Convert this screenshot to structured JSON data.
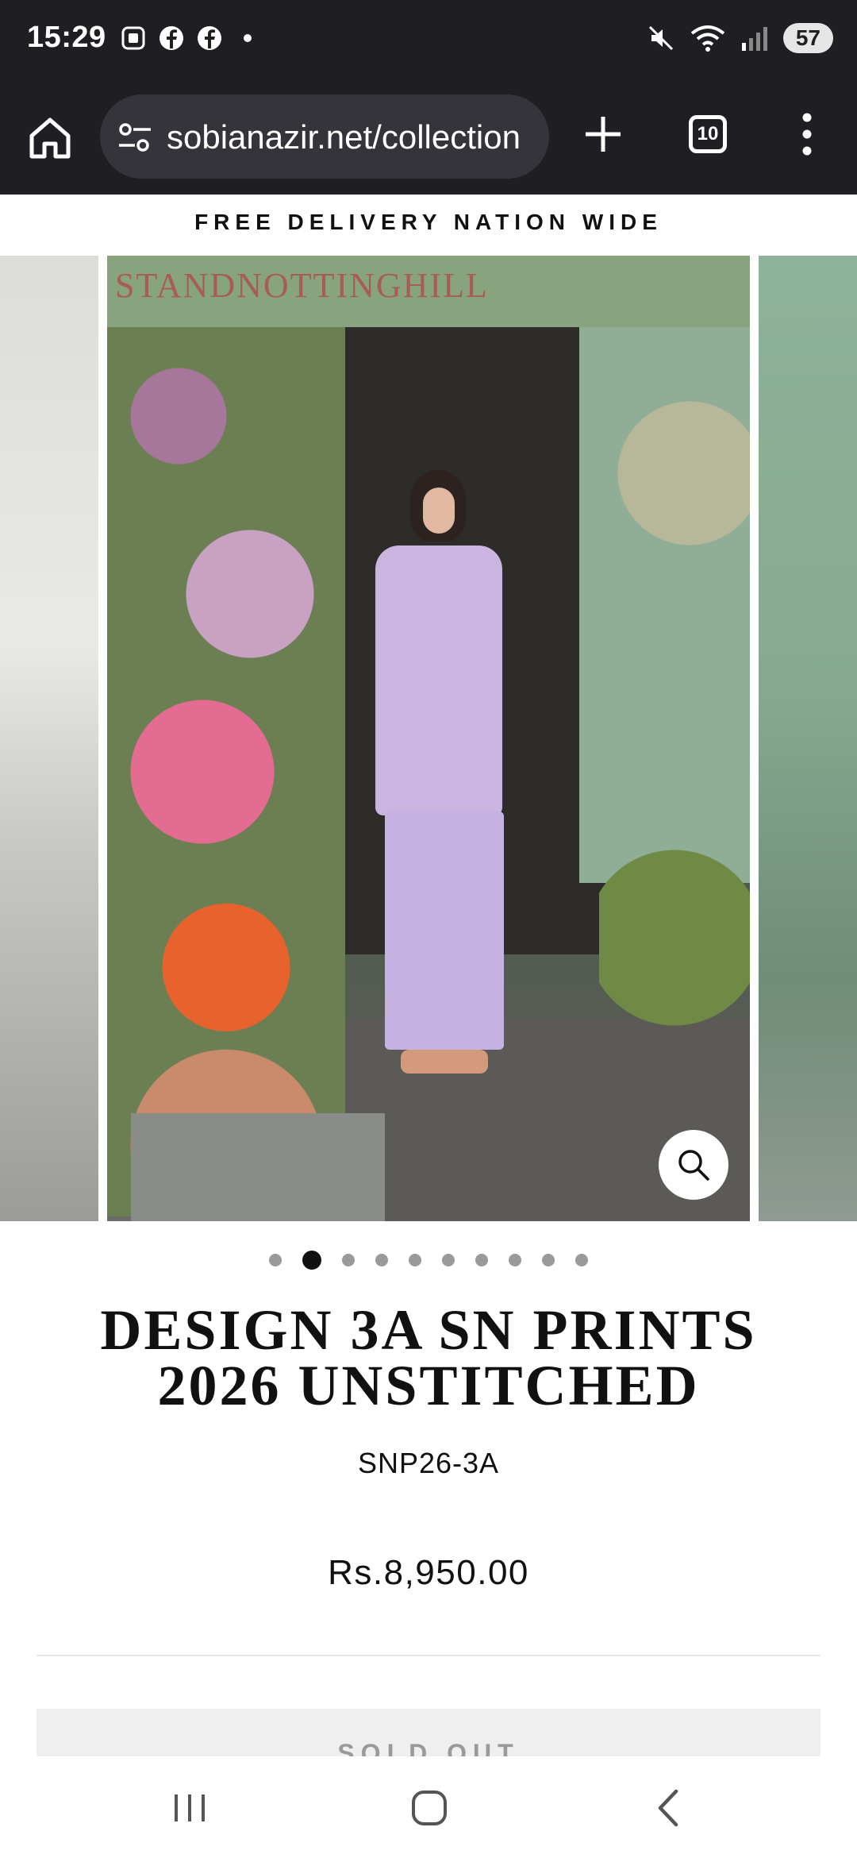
{
  "status_bar": {
    "time": "15:29",
    "battery": "57",
    "left_icons": [
      "screenshot-icon",
      "facebook-icon",
      "facebook-icon",
      "dot-icon"
    ],
    "right_icons": [
      "mute-icon",
      "wifi-icon",
      "signal-icon"
    ]
  },
  "browser": {
    "url": "sobianazir.net/collection",
    "tab_count": "10"
  },
  "promo": {
    "text": "FREE DELIVERY NATION WIDE"
  },
  "gallery": {
    "sign_text": "STANDNOTTINGHILL",
    "total_dots": 10,
    "active_index": 1
  },
  "product": {
    "title": "DESIGN 3A SN PRINTS 2026 UNSTITCHED",
    "sku": "SNP26-3A",
    "price": "Rs.8,950.00",
    "button_label": "SOLD OUT"
  },
  "colors": {
    "status_bg": "#1f1f23",
    "omnibox_bg": "#34343a",
    "text": "#111111",
    "sold_out_bg": "#efefef"
  }
}
